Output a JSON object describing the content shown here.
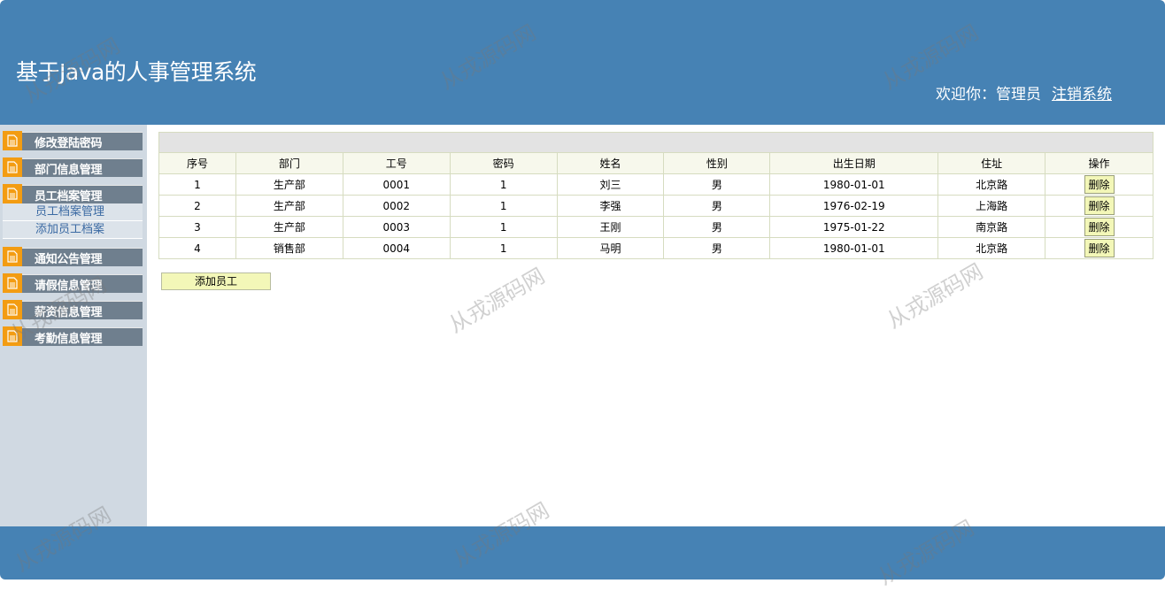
{
  "header": {
    "title": "基于Java的人事管理系统",
    "welcome": "欢迎你：管理员",
    "logout": "注销系统"
  },
  "sidebar": {
    "groups": [
      {
        "label": "修改登陆密码"
      },
      {
        "label": "部门信息管理"
      },
      {
        "label": "员工档案管理",
        "items": [
          "员工档案管理",
          "添加员工档案"
        ]
      },
      {
        "label": "通知公告管理"
      },
      {
        "label": "请假信息管理"
      },
      {
        "label": "薪资信息管理"
      },
      {
        "label": "考勤信息管理"
      }
    ]
  },
  "table": {
    "columns": [
      "序号",
      "部门",
      "工号",
      "密码",
      "姓名",
      "性别",
      "出生日期",
      "住址",
      "操作"
    ],
    "rows": [
      [
        "1",
        "生产部",
        "0001",
        "1",
        "刘三",
        "男",
        "1980-01-01",
        "北京路",
        "删除"
      ],
      [
        "2",
        "生产部",
        "0002",
        "1",
        "李强",
        "男",
        "1976-02-19",
        "上海路",
        "删除"
      ],
      [
        "3",
        "生产部",
        "0003",
        "1",
        "王刚",
        "男",
        "1975-01-22",
        "南京路",
        "删除"
      ],
      [
        "4",
        "销售部",
        "0004",
        "1",
        "马明",
        "男",
        "1980-01-01",
        "北京路",
        "删除"
      ]
    ]
  },
  "add_button": "添加员工",
  "watermark": "从戎源码网",
  "colors": {
    "header": "#4682b4",
    "sidebar_bg": "#d0d9e2",
    "menu_head": "#6f7f8e",
    "icon": "#f39c12"
  }
}
